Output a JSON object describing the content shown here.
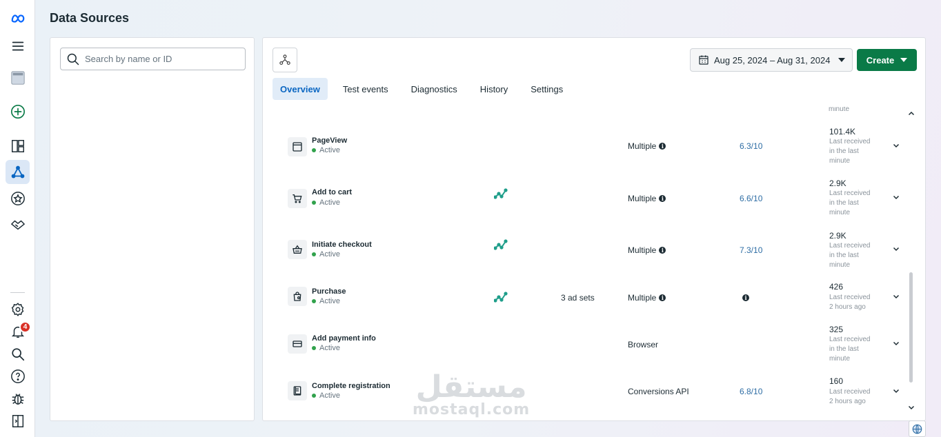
{
  "page": {
    "title": "Data Sources"
  },
  "search": {
    "placeholder": "Search by name or ID"
  },
  "toolbar": {
    "date_range": "Aug 25, 2024 – Aug 31, 2024",
    "create_label": "Create"
  },
  "tabs": [
    {
      "label": "Overview",
      "active": true
    },
    {
      "label": "Test events"
    },
    {
      "label": "Diagnostics"
    },
    {
      "label": "History"
    },
    {
      "label": "Settings"
    }
  ],
  "events": {
    "previous_tail": "minute",
    "rows": [
      {
        "name": "PageView",
        "status": "Active",
        "icon": "browser-window-icon",
        "method": "Multiple",
        "score": "6.3/10",
        "count": "101.4K",
        "received": "Last received in the last minute"
      },
      {
        "name": "Add to cart",
        "status": "Active",
        "icon": "cart-icon",
        "trend": true,
        "method": "Multiple",
        "score": "6.6/10",
        "count": "2.9K",
        "received": "Last received in the last minute"
      },
      {
        "name": "Initiate checkout",
        "status": "Active",
        "icon": "basket-icon",
        "trend": true,
        "method": "Multiple",
        "score": "7.3/10",
        "count": "2.9K",
        "received": "Last received in the last minute"
      },
      {
        "name": "Purchase",
        "status": "Active",
        "icon": "shopping-bag-icon",
        "trend": true,
        "ad_sets": "3 ad sets",
        "method": "Multiple",
        "score": "",
        "count": "426",
        "received": "Last received 2 hours ago"
      },
      {
        "name": "Add payment info",
        "status": "Active",
        "icon": "credit-card-icon",
        "method": "Browser",
        "score": "",
        "count": "325",
        "received": "Last received in the last minute"
      },
      {
        "name": "Complete registration",
        "status": "Active",
        "icon": "registration-form-icon",
        "method": "Conversions API",
        "score": "6.8/10",
        "count": "160",
        "received": "Last received 2 hours ago"
      }
    ]
  },
  "notifications": {
    "count": "4"
  },
  "watermark": {
    "arabic": "مستقل",
    "latin": "mostaql.com"
  },
  "colors": {
    "accent": "#0a66c2",
    "create": "#0a7a47",
    "active_dot": "#31a24c",
    "trend": "#1f9e8a",
    "badge": "#d93025"
  }
}
